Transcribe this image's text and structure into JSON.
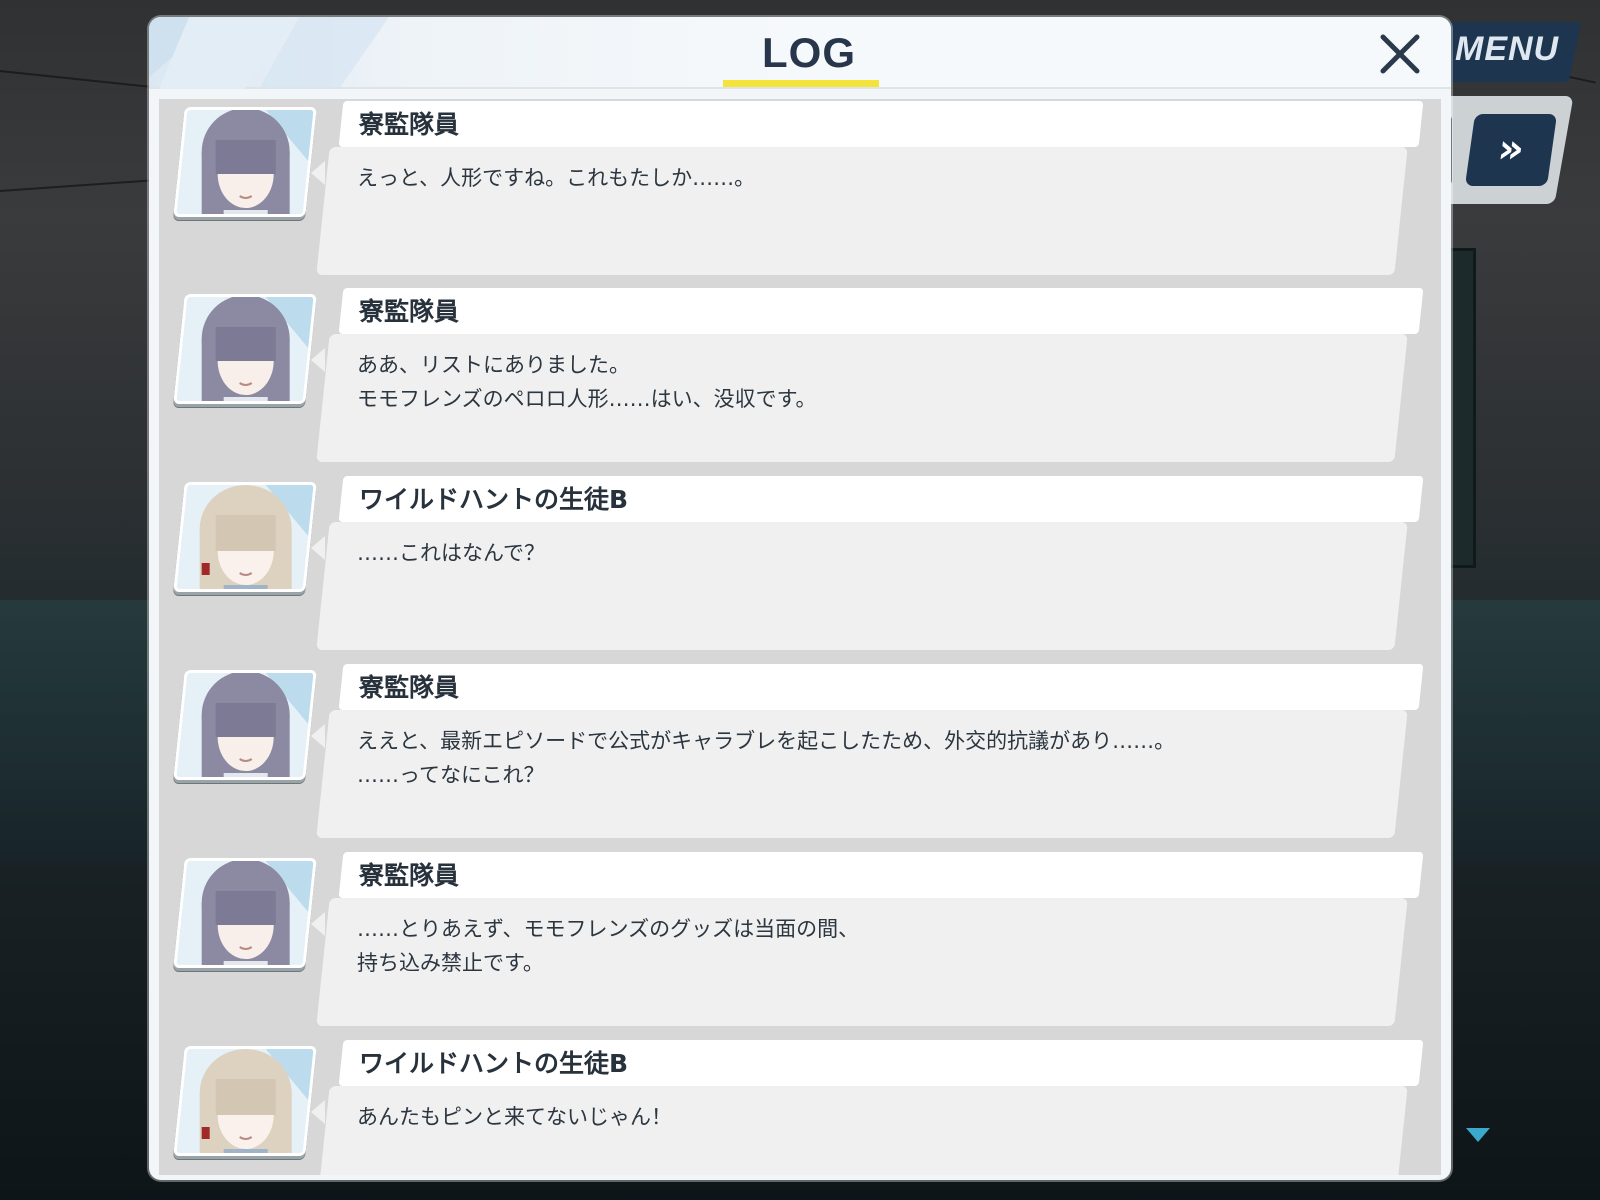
{
  "header": {
    "title": "LOG",
    "close_icon": "close-icon",
    "accent_color": "#f4e33a",
    "title_color": "#27364a"
  },
  "hud": {
    "menu_label": "MENU",
    "fast_forward_icon": "double-chevron-right-icon",
    "scroll_indicator_icon": "triangle-down-icon",
    "hud_color": "#1e3550"
  },
  "entries": [
    {
      "speaker": "寮監隊員",
      "portrait": "dorm-supervisor-avatar",
      "text": "えっと、人形ですね。これもたしか……。"
    },
    {
      "speaker": "寮監隊員",
      "portrait": "dorm-supervisor-avatar",
      "text": "ああ、リストにありました。\nモモフレンズのペロロ人形……はい、没収です。"
    },
    {
      "speaker": "ワイルドハントの生徒B",
      "portrait": "student-b-avatar",
      "text": "……これはなんで？"
    },
    {
      "speaker": "寮監隊員",
      "portrait": "dorm-supervisor-avatar",
      "text": "ええと、最新エピソードで公式がキャラブレを起こしたため、外交的抗議があり……。\n……ってなにこれ？"
    },
    {
      "speaker": "寮監隊員",
      "portrait": "dorm-supervisor-avatar",
      "text": "……とりあえず、モモフレンズのグッズは当面の間、\n持ち込み禁止です。"
    },
    {
      "speaker": "ワイルドハントの生徒B",
      "portrait": "student-b-avatar",
      "text": "あんたもピンと来てないじゃん！"
    }
  ]
}
